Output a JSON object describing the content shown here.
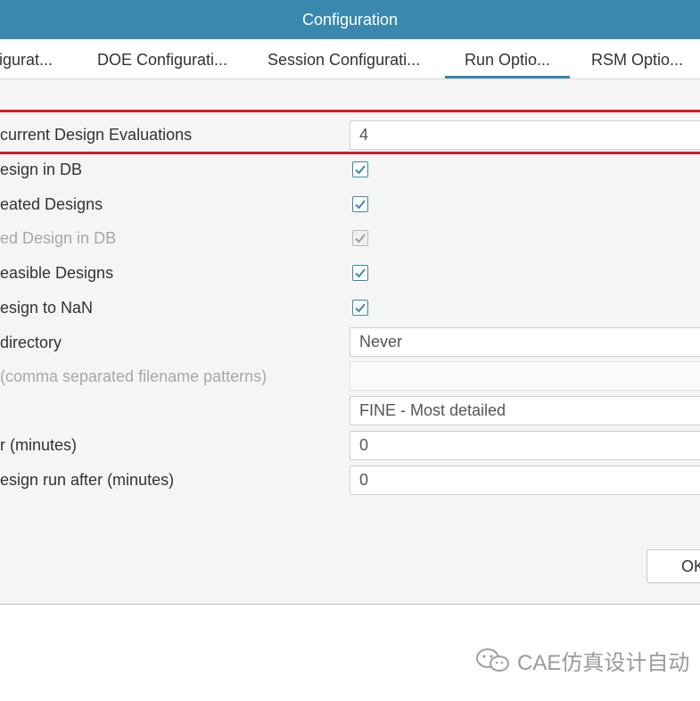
{
  "window": {
    "title": "Configuration"
  },
  "tabs": [
    {
      "label": "figurat..."
    },
    {
      "label": "DOE Configurati..."
    },
    {
      "label": "Session Configurati..."
    },
    {
      "label": "Run Optio...",
      "active": true
    },
    {
      "label": "RSM Optio..."
    }
  ],
  "rows": [
    {
      "label": "current Design Evaluations",
      "type": "text",
      "value": "4",
      "highlighted": true
    },
    {
      "label": "esign in DB",
      "type": "checkbox",
      "checked": true
    },
    {
      "label": "eated Designs",
      "type": "checkbox",
      "checked": true
    },
    {
      "label": "ed Design in DB",
      "type": "checkbox",
      "checked": true,
      "disabled": true
    },
    {
      "label": "easible Designs",
      "type": "checkbox",
      "checked": true
    },
    {
      "label": "esign to NaN",
      "type": "checkbox",
      "checked": true
    },
    {
      "label": " directory",
      "type": "select",
      "value": "Never"
    },
    {
      "label": "(comma separated filename patterns)",
      "type": "text",
      "value": "",
      "disabled": true
    },
    {
      "label": "",
      "type": "select",
      "value": "FINE - Most detailed"
    },
    {
      "label": "r (minutes)",
      "type": "text",
      "value": "0"
    },
    {
      "label": "esign run after (minutes)",
      "type": "text",
      "value": "0"
    }
  ],
  "buttons": {
    "ok": "OK"
  },
  "watermark": {
    "text": "CAE仿真设计自动"
  },
  "colors": {
    "titlebar": "#3a88ad",
    "highlight": "#d8191f",
    "checkbox": "#3a88ad"
  }
}
